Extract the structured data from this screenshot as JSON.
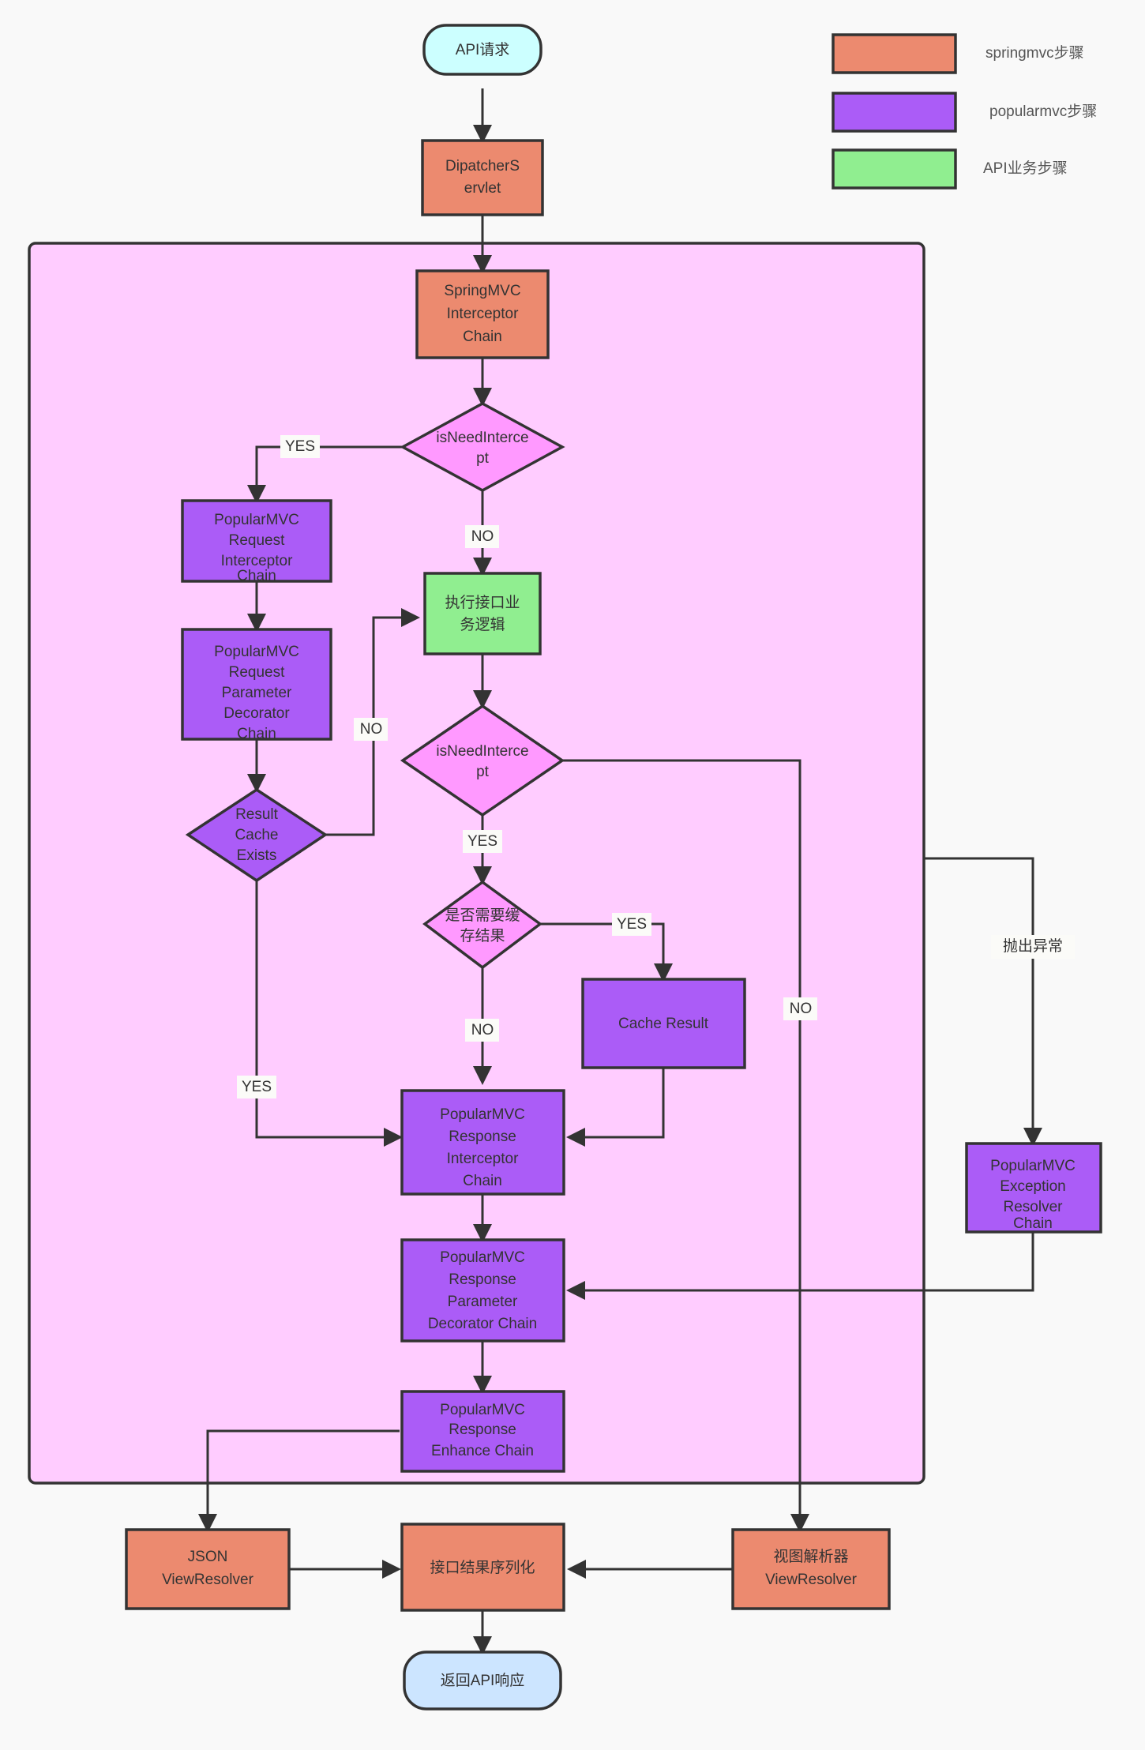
{
  "diagram": {
    "title": "PopularMVC request processing flow",
    "background": "#f9f9f9",
    "stroke": "#333333"
  },
  "colors": {
    "springmvc": "#ec8a6f",
    "popularmvc": "#ab5cf7",
    "api_business": "#90ee90",
    "terminal": "#cce5ff",
    "terminal_start": "#ccffff",
    "decision_pink": "#ff99ff",
    "cluster": "#ffccff"
  },
  "legend": {
    "items": [
      {
        "label": "springmvc步骤",
        "color": "#ec8a6f"
      },
      {
        "label": "popularmvc步骤",
        "color": "#ab5cf7"
      },
      {
        "label": "API业务步骤",
        "color": "#90ee90"
      }
    ]
  },
  "nodes": {
    "api_request": {
      "label": "API请求",
      "type": "terminal",
      "color": "#ccffff"
    },
    "dispatcher_servlet": {
      "label": "DipatcherS\nervlet",
      "type": "process",
      "color": "#ec8a6f"
    },
    "springmvc_interceptor": {
      "label": "SpringMVC\nInterceptor\nChain",
      "type": "process",
      "color": "#ec8a6f"
    },
    "is_need_intercept_1": {
      "label": "isNeedInterce\npt",
      "type": "decision",
      "color": "#ff99ff"
    },
    "popular_req_interceptor": {
      "label": "PopularMVC\nRequest\nInterceptor\nChain",
      "type": "process",
      "color": "#ab5cf7"
    },
    "popular_req_param_dec": {
      "label": "PopularMVC\nRequest\nParameter\nDecorator\nChain",
      "type": "process",
      "color": "#ab5cf7"
    },
    "result_cache_exists": {
      "label": "Result\nCache\nExists",
      "type": "decision",
      "color": "#ab5cf7"
    },
    "exec_api_logic": {
      "label": "执行接口业\n务逻辑",
      "type": "process",
      "color": "#90ee90"
    },
    "is_need_intercept_2": {
      "label": "isNeedInterce\npt",
      "type": "decision",
      "color": "#ff99ff"
    },
    "need_cache_result": {
      "label": "是否需要缓\n存结果",
      "type": "decision",
      "color": "#ff99ff"
    },
    "cache_result": {
      "label": "Cache Result",
      "type": "process",
      "color": "#ab5cf7"
    },
    "popular_resp_interceptor": {
      "label": "PopularMVC\nResponse\nInterceptor\nChain",
      "type": "process",
      "color": "#ab5cf7"
    },
    "popular_resp_param_dec": {
      "label": "PopularMVC\nResponse\nParameter\nDecorator Chain",
      "type": "process",
      "color": "#ab5cf7"
    },
    "popular_resp_enhance": {
      "label": "PopularMVC\nResponse\nEnhance Chain",
      "type": "process",
      "color": "#ab5cf7"
    },
    "popular_exception_resolver": {
      "label": "PopularMVC\nException\nResolver\nChain",
      "type": "process",
      "color": "#ab5cf7"
    },
    "json_view_resolver": {
      "label": "JSON\nViewResolver",
      "type": "process",
      "color": "#ec8a6f"
    },
    "result_serialize": {
      "label": "接口结果序列化",
      "type": "process",
      "color": "#ec8a6f"
    },
    "view_resolver": {
      "label": "视图解析器\nViewResolver",
      "type": "process",
      "color": "#ec8a6f"
    },
    "api_response": {
      "label": "返回API响应",
      "type": "terminal",
      "color": "#cce5ff"
    }
  },
  "edge_labels": {
    "yes_intercept_1": "YES",
    "no_intercept_1": "NO",
    "no_cache_exists": "NO",
    "yes_cache_exists": "YES",
    "yes_intercept_2": "YES",
    "no_intercept_2": "NO",
    "yes_need_cache": "YES",
    "no_need_cache": "NO",
    "throw_exception": "抛出异常"
  }
}
